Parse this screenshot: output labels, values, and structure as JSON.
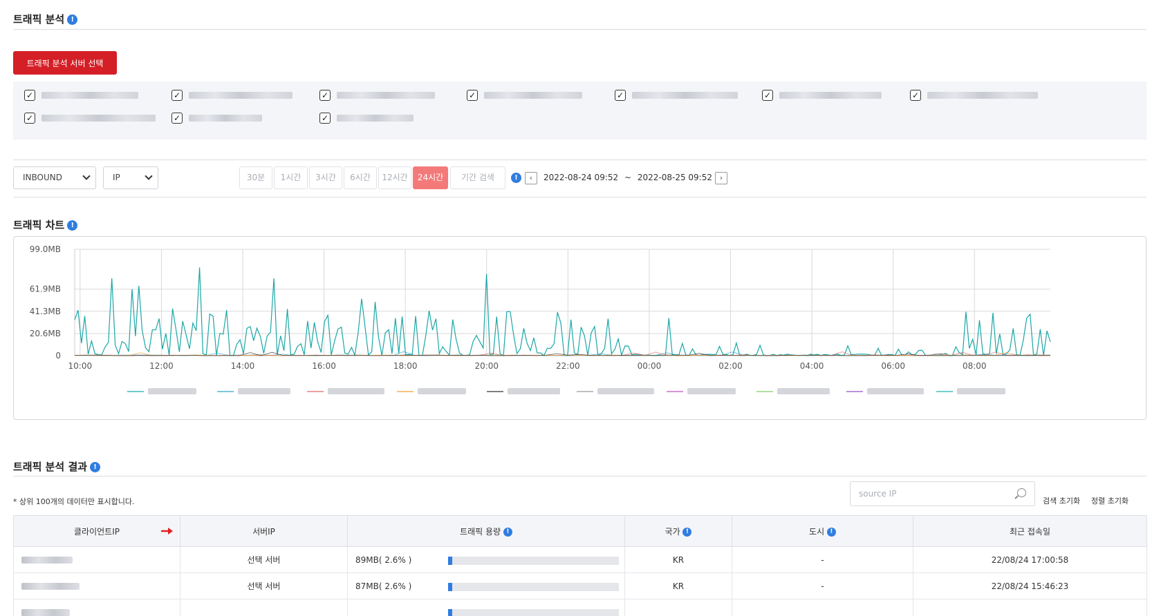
{
  "header": {
    "title": "트래픽 분석"
  },
  "server_select": {
    "button_label": "트래픽 분석 서버 선택",
    "servers": [
      {
        "checked": true
      },
      {
        "checked": true
      },
      {
        "checked": true
      },
      {
        "checked": true
      },
      {
        "checked": true
      },
      {
        "checked": true
      },
      {
        "checked": true
      },
      {
        "checked": true
      },
      {
        "checked": true
      },
      {
        "checked": true
      }
    ]
  },
  "filters": {
    "direction": "INBOUND",
    "group_by": "IP",
    "ranges": [
      "30분",
      "1시간",
      "3시간",
      "6시간",
      "12시간",
      "24시간",
      "기간 검색"
    ],
    "active_range": "24시간",
    "date_start": "2022-08-24 09:52",
    "date_sep": "~",
    "date_end": "2022-08-25 09:52"
  },
  "chart_section": {
    "title": "트래픽 차트"
  },
  "chart_data": {
    "type": "line",
    "title": "",
    "y_ticks": [
      "99.0MB",
      "61.9MB",
      "41.3MB",
      "20.6MB",
      "0"
    ],
    "y_tick_values": [
      99.0,
      61.9,
      41.3,
      20.6,
      0
    ],
    "ylim": [
      0,
      99.0
    ],
    "x_ticks": [
      "10:00",
      "12:00",
      "14:00",
      "16:00",
      "18:00",
      "20:00",
      "22:00",
      "00:00",
      "02:00",
      "04:00",
      "06:00",
      "08:00"
    ],
    "grid": true,
    "legend_position": "bottom",
    "series_colors": [
      "#1aa6a6",
      "#2aa6c9",
      "#e06666",
      "#f0a030",
      "#333333",
      "#999999",
      "#c050c0",
      "#80d060",
      "#9050c0",
      "#20b0b0"
    ],
    "main_series_peaks": [
      {
        "x": "10:45",
        "y": 72
      },
      {
        "x": "11:15",
        "y": 62
      },
      {
        "x": "11:25",
        "y": 65
      },
      {
        "x": "12:55",
        "y": 82
      },
      {
        "x": "14:45",
        "y": 72
      },
      {
        "x": "16:55",
        "y": 53
      },
      {
        "x": "17:15",
        "y": 50
      },
      {
        "x": "20:00",
        "y": 76
      },
      {
        "x": "20:30",
        "y": 41
      },
      {
        "x": "00:30",
        "y": 35
      },
      {
        "x": "09:15",
        "y": 35
      }
    ]
  },
  "results_section": {
    "title": "트래픽 분석 결과",
    "note": "* 상위 100개의 데이터만 표시합니다.",
    "search_placeholder": "source IP",
    "reset_search": "검색 초기화",
    "reset_sort": "정렬 초기화",
    "columns": [
      "클라이언트IP",
      "서버IP",
      "트래픽 용량",
      "국가",
      "도시",
      "최근 접속일"
    ],
    "rows": [
      {
        "server": "선택 서버",
        "traffic": "89MB( 2.6% )",
        "traffic_pct": 2.6,
        "country": "KR",
        "city": "-",
        "last": "22/08/24 17:00:58"
      },
      {
        "server": "선택 서버",
        "traffic": "87MB( 2.6% )",
        "traffic_pct": 2.6,
        "country": "KR",
        "city": "-",
        "last": "22/08/24 15:46:23"
      },
      {
        "server": "",
        "traffic": "",
        "traffic_pct": 2.5,
        "country": "",
        "city": "",
        "last": ""
      }
    ]
  }
}
